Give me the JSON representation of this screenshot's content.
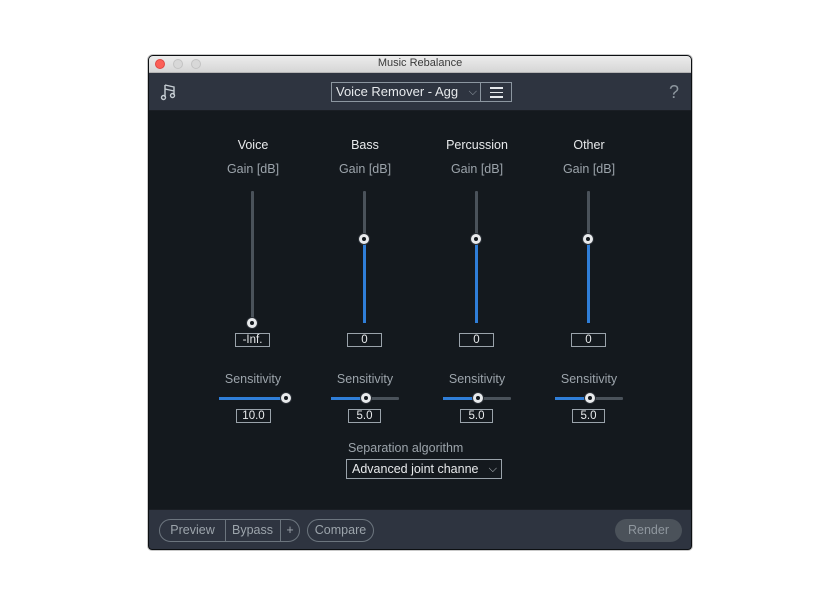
{
  "window": {
    "title": "Music Rebalance"
  },
  "toolbar": {
    "preset_value": "Voice Remover - Agg",
    "help_label": "?"
  },
  "columns": [
    {
      "name": "Voice",
      "gain_label": "Gain [dB]",
      "gain_value": "-Inf.",
      "sensitivity_label": "Sensitivity",
      "sensitivity_value": "10.0"
    },
    {
      "name": "Bass",
      "gain_label": "Gain [dB]",
      "gain_value": "0",
      "sensitivity_label": "Sensitivity",
      "sensitivity_value": "5.0"
    },
    {
      "name": "Percussion",
      "gain_label": "Gain [dB]",
      "gain_value": "0",
      "sensitivity_label": "Sensitivity",
      "sensitivity_value": "5.0"
    },
    {
      "name": "Other",
      "gain_label": "Gain [dB]",
      "gain_value": "0",
      "sensitivity_label": "Sensitivity",
      "sensitivity_value": "5.0"
    }
  ],
  "separation": {
    "label": "Separation algorithm",
    "value": "Advanced joint channe"
  },
  "footer": {
    "preview_label": "Preview",
    "bypass_label": "Bypass",
    "plus_label": "+",
    "compare_label": "Compare",
    "render_label": "Render"
  },
  "colors": {
    "accent": "#2f7ed8",
    "panel": "#14191e",
    "toolbar": "#2e3440"
  }
}
